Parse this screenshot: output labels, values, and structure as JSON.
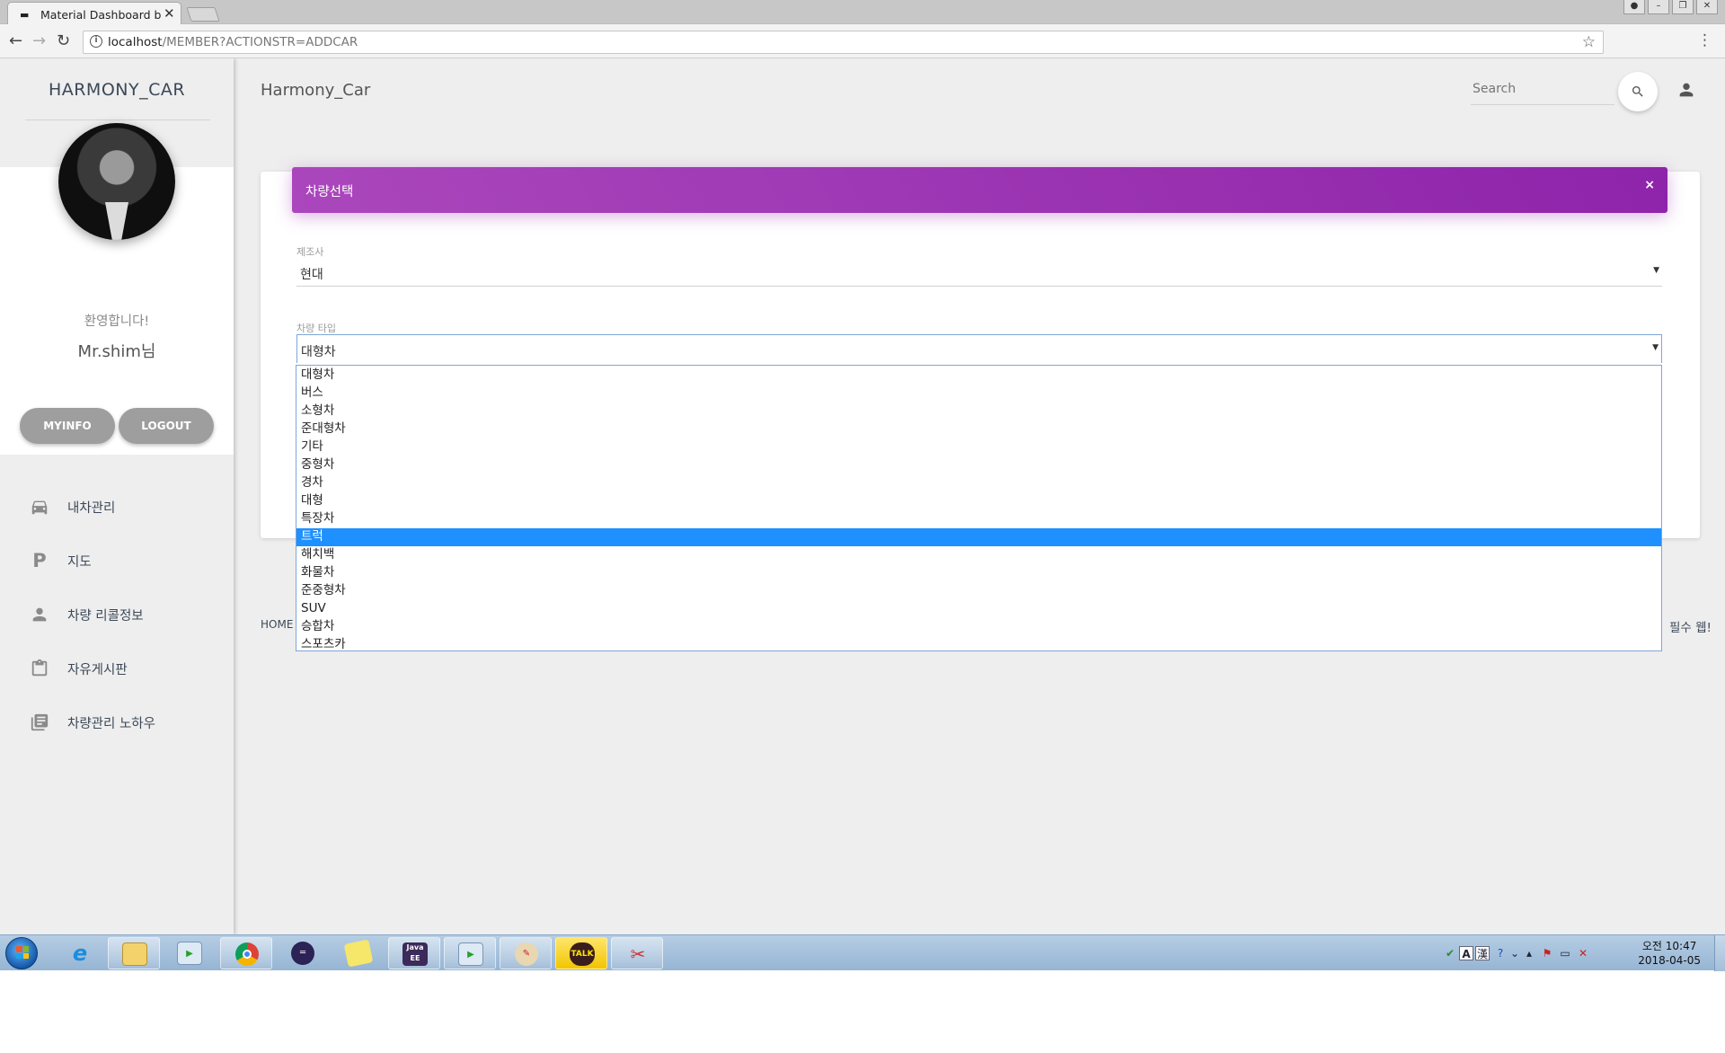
{
  "browser": {
    "tab_title": "Material Dashboard by C",
    "tab_close": "✕",
    "url_host": "localhost",
    "url_path": "/MEMBER?ACTIONSTR=ADDCAR"
  },
  "sidebar": {
    "brand": "HARMONY_CAR",
    "welcome": "환영합니다!",
    "username": "Mr.shim님",
    "myinfo_label": "MYINFO",
    "logout_label": "LOGOUT",
    "items": [
      {
        "label": "내차관리",
        "icon": "car-icon"
      },
      {
        "label": "지도",
        "icon": "parking-icon"
      },
      {
        "label": "차량 리콜정보",
        "icon": "person-icon"
      },
      {
        "label": "자유게시판",
        "icon": "clipboard-icon"
      },
      {
        "label": "차량관리 노하우",
        "icon": "library-books-icon"
      }
    ]
  },
  "topnav": {
    "title": "Harmony_Car",
    "search_placeholder": "Search"
  },
  "card": {
    "title": "차량선택",
    "close": "×",
    "maker_label": "제조사",
    "maker_value": "현대",
    "type_label": "차량 타입",
    "type_value": "대형차",
    "type_options": [
      "대형차",
      "버스",
      "소형차",
      "준대형차",
      "기타",
      "중형차",
      "경차",
      "대형",
      "특장차",
      "트럭",
      "해치백",
      "화물차",
      "준중형차",
      "SUV",
      "승합차",
      "스포츠카"
    ],
    "highlighted_option": "트럭"
  },
  "footer": {
    "home": "HOME",
    "right_text": "필수 웹!"
  },
  "taskbar": {
    "clock_time": "오전 10:47",
    "clock_date": "2018-04-05"
  },
  "colors": {
    "accent_purple": "#9c27b0",
    "selection_blue": "#1e90ff",
    "pill_gray": "#9e9e9e"
  }
}
